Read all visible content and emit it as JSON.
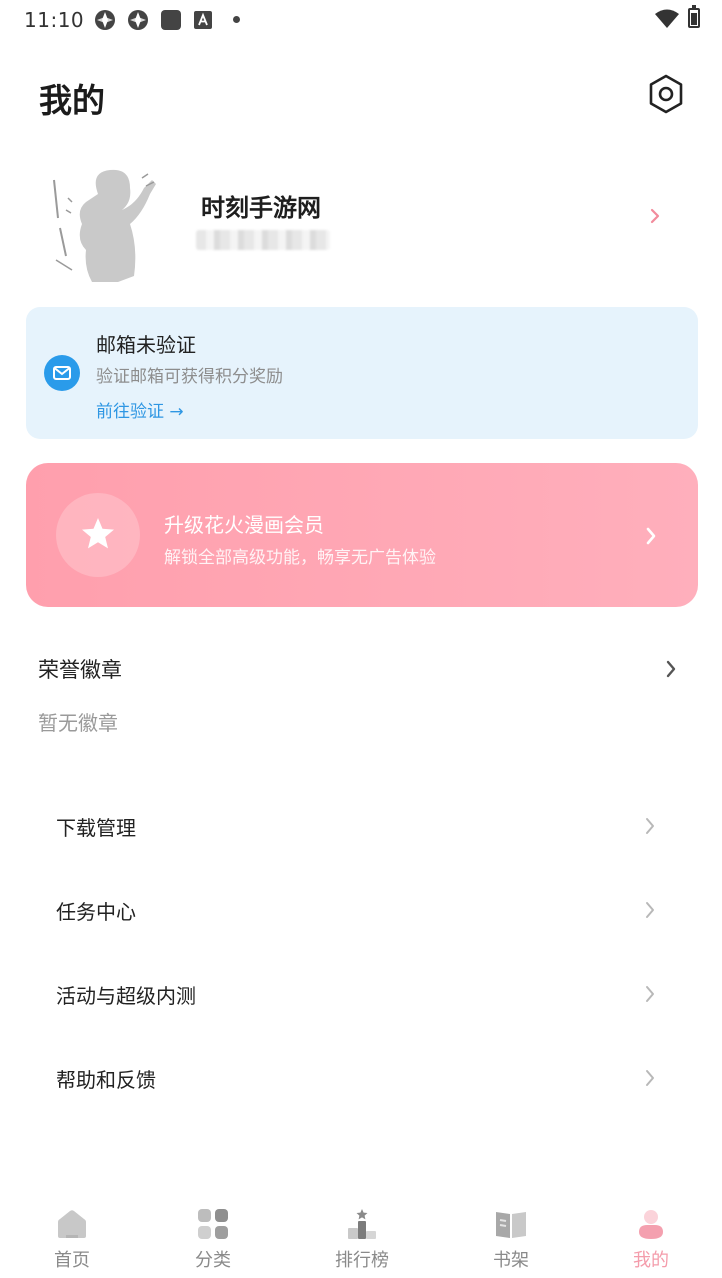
{
  "status_bar": {
    "time": "11:10"
  },
  "header": {
    "title": "我的",
    "settings_icon": "gear-hexagon-icon"
  },
  "profile": {
    "username": "时刻手游网"
  },
  "email_card": {
    "title": "邮箱未验证",
    "description": "验证邮箱可获得积分奖励",
    "link": "前往验证 →",
    "accent_color": "#2a9bea"
  },
  "vip_card": {
    "title": "升级花火漫画会员",
    "description": "解锁全部高级功能，畅享无广告体验",
    "color": "#ffa6b4"
  },
  "badges": {
    "title": "荣誉徽章",
    "empty_text": "暂无徽章"
  },
  "menu": {
    "items": [
      {
        "label": "下载管理"
      },
      {
        "label": "任务中心"
      },
      {
        "label": "活动与超级内测"
      },
      {
        "label": "帮助和反馈"
      }
    ]
  },
  "bottom_nav": {
    "items": [
      {
        "label": "首页",
        "icon": "home-icon"
      },
      {
        "label": "分类",
        "icon": "category-grid-icon"
      },
      {
        "label": "排行榜",
        "icon": "ranking-podium-icon"
      },
      {
        "label": "书架",
        "icon": "bookshelf-icon"
      },
      {
        "label": "我的",
        "icon": "profile-person-icon",
        "active": true
      }
    ],
    "active_color": "#f49cab"
  }
}
